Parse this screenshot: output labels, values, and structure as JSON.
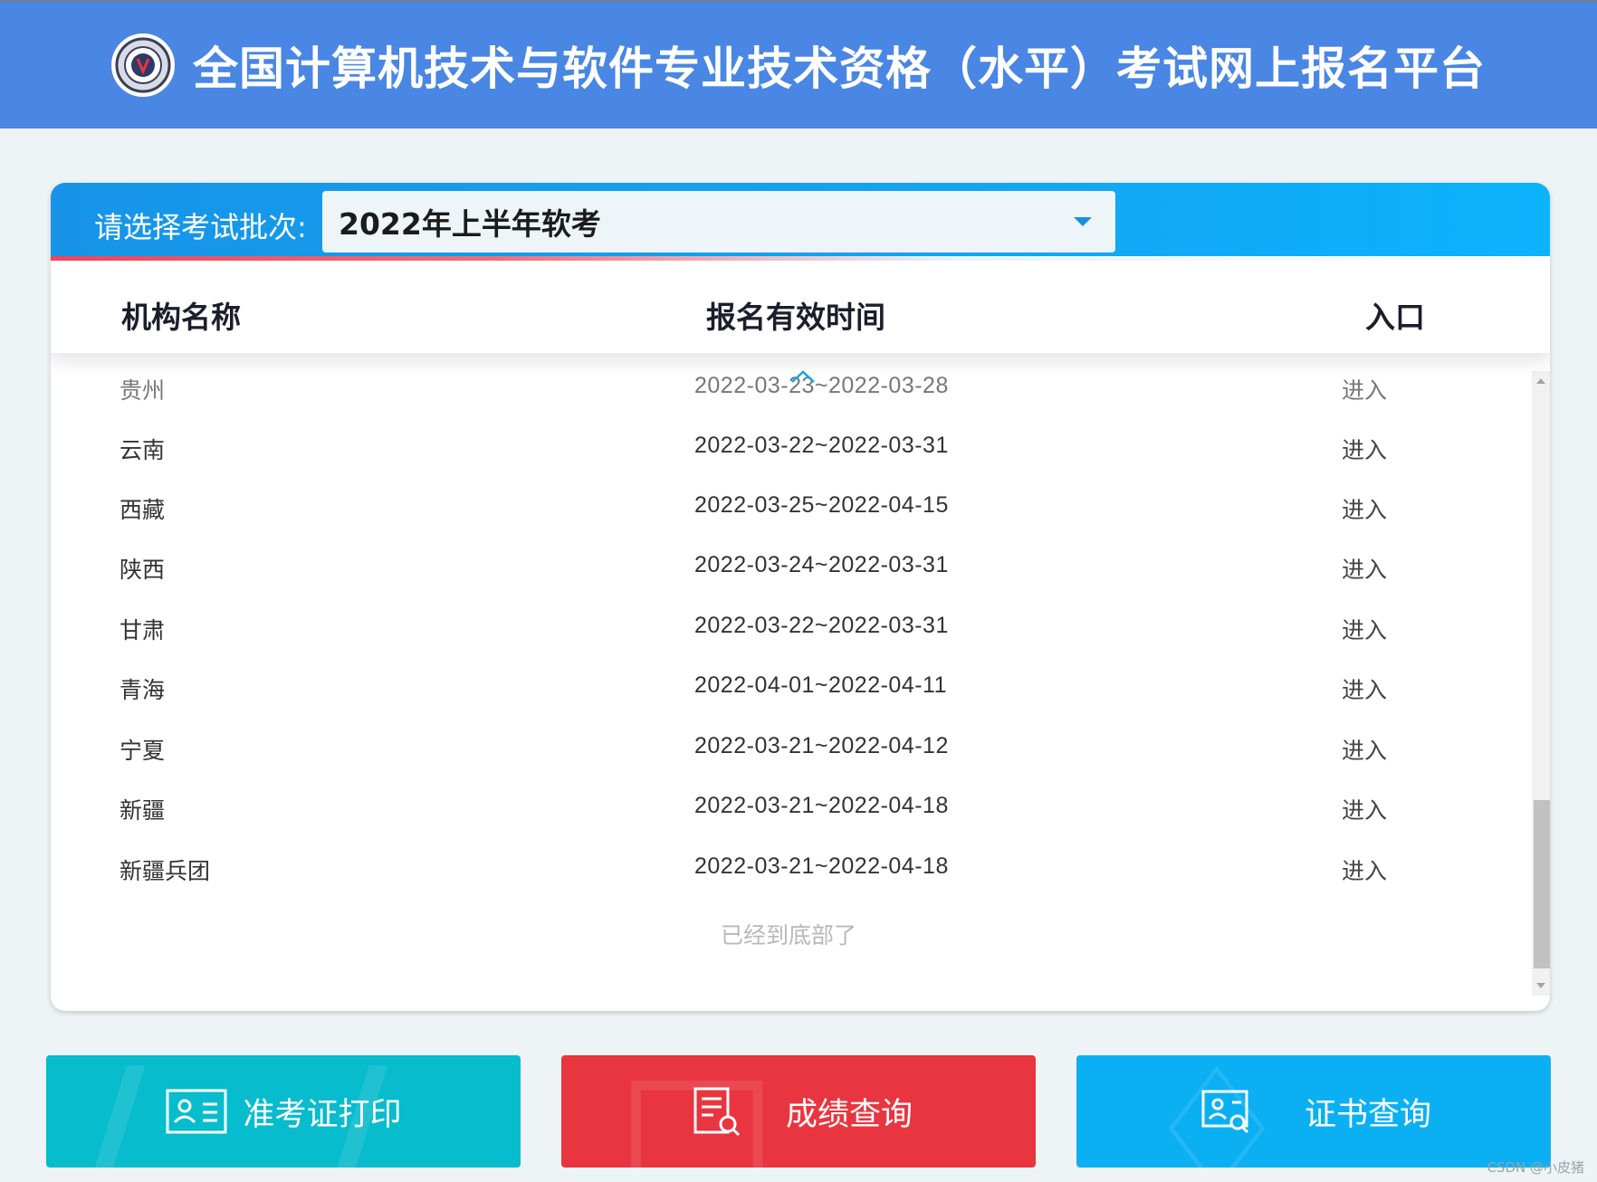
{
  "header": {
    "title": "全国计算机技术与软件专业技术资格（水平）考试网上报名平台",
    "logo_icon": "rk-seal-logo-icon"
  },
  "batch": {
    "label": "请选择考试批次:",
    "selected": "2022年上半年软考"
  },
  "table": {
    "columns": [
      "机构名称",
      "报名有效时间",
      "入口"
    ],
    "rows": [
      {
        "org": "贵州",
        "time": "2022-03-23~2022-03-28",
        "entry": "进入"
      },
      {
        "org": "云南",
        "time": "2022-03-22~2022-03-31",
        "entry": "进入"
      },
      {
        "org": "西藏",
        "time": "2022-03-25~2022-04-15",
        "entry": "进入"
      },
      {
        "org": "陕西",
        "time": "2022-03-24~2022-03-31",
        "entry": "进入"
      },
      {
        "org": "甘肃",
        "time": "2022-03-22~2022-03-31",
        "entry": "进入"
      },
      {
        "org": "青海",
        "time": "2022-04-01~2022-04-11",
        "entry": "进入"
      },
      {
        "org": "宁夏",
        "time": "2022-03-21~2022-04-12",
        "entry": "进入"
      },
      {
        "org": "新疆",
        "time": "2022-03-21~2022-04-18",
        "entry": "进入"
      },
      {
        "org": "新疆兵团",
        "time": "2022-03-21~2022-04-18",
        "entry": "进入"
      }
    ],
    "bottom_note": "已经到底部了"
  },
  "actions": [
    {
      "label": "准考证打印",
      "icon": "id-card-icon",
      "color": "#07bccd"
    },
    {
      "label": "成绩查询",
      "icon": "document-search-icon",
      "color": "#e9353f"
    },
    {
      "label": "证书查询",
      "icon": "certificate-search-icon",
      "color": "#0bb0f3"
    }
  ],
  "watermark": "CSDN @小皮猪"
}
